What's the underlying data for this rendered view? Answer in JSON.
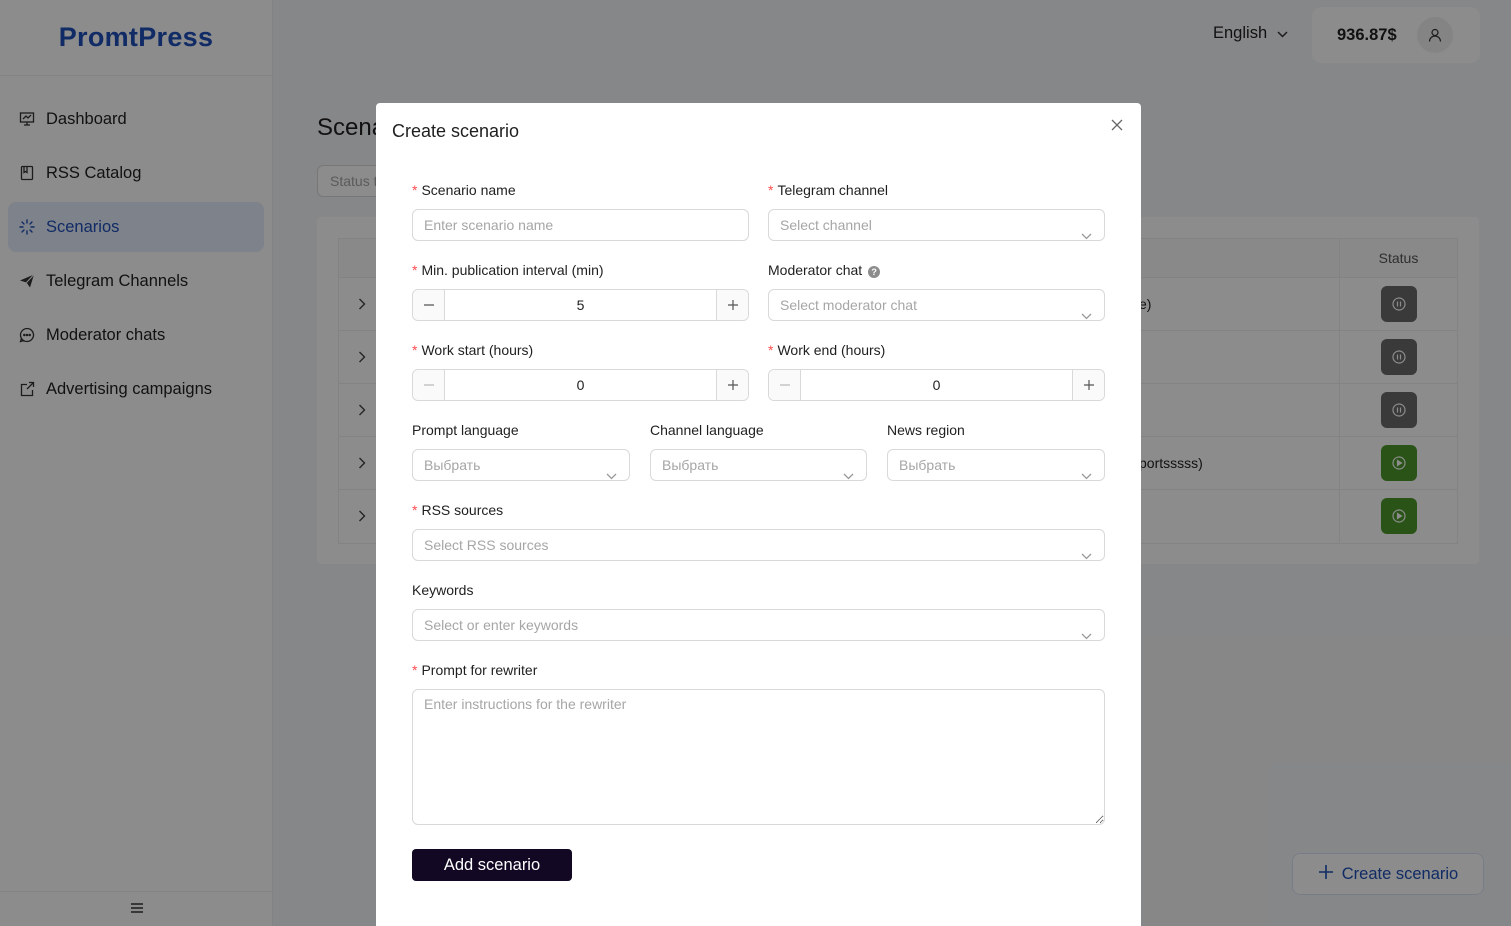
{
  "app": {
    "logo": "PromtPress"
  },
  "sidebar": {
    "items": [
      {
        "label": "Dashboard",
        "icon": "dashboard-icon"
      },
      {
        "label": "RSS Catalog",
        "icon": "book-icon"
      },
      {
        "label": "Scenarios",
        "icon": "loading-icon",
        "active": true
      },
      {
        "label": "Telegram Channels",
        "icon": "send-icon"
      },
      {
        "label": "Moderator chats",
        "icon": "message-icon"
      },
      {
        "label": "Advertising campaigns",
        "icon": "export-icon"
      }
    ],
    "footer_icon": "menu-icon"
  },
  "header": {
    "language": "English",
    "balance": "936.87$",
    "avatar_icon": "user-icon"
  },
  "page": {
    "title": "Scena",
    "filter_placeholder": "Status t",
    "table": {
      "status_header": "Status",
      "rows": [
        {
          "desc": "e)",
          "status": "paused"
        },
        {
          "desc": "",
          "status": "paused"
        },
        {
          "desc": "",
          "status": "paused"
        },
        {
          "desc": "portsssss)",
          "status": "active"
        },
        {
          "desc": "",
          "status": "active"
        }
      ]
    },
    "create_button": "Create scenario",
    "colors": {
      "paused": "#6b6b6b",
      "active": "#4d9a2a",
      "primary": "#1e4fb8"
    }
  },
  "modal": {
    "title": "Create scenario",
    "fields": {
      "scenario_name": {
        "label": "Scenario name",
        "required": true,
        "placeholder": "Enter scenario name",
        "value": ""
      },
      "telegram_channel": {
        "label": "Telegram channel",
        "required": true,
        "placeholder": "Select channel"
      },
      "min_interval": {
        "label": "Min. publication interval (min)",
        "required": true,
        "value": "5"
      },
      "moderator_chat": {
        "label": "Moderator chat",
        "required": false,
        "placeholder": "Select moderator chat"
      },
      "work_start": {
        "label": "Work start (hours)",
        "required": true,
        "value": "0"
      },
      "work_end": {
        "label": "Work end (hours)",
        "required": true,
        "value": "0"
      },
      "prompt_language": {
        "label": "Prompt language",
        "placeholder": "Выбрать"
      },
      "channel_language": {
        "label": "Channel language",
        "placeholder": "Выбрать"
      },
      "news_region": {
        "label": "News region",
        "placeholder": "Выбрать"
      },
      "rss_sources": {
        "label": "RSS sources",
        "required": true,
        "placeholder": "Select RSS sources"
      },
      "keywords": {
        "label": "Keywords",
        "placeholder": "Select or enter keywords"
      },
      "prompt": {
        "label": "Prompt for rewriter",
        "required": true,
        "placeholder": "Enter instructions for the rewriter"
      }
    },
    "required_mark": "*",
    "submit_label": "Add scenario"
  }
}
